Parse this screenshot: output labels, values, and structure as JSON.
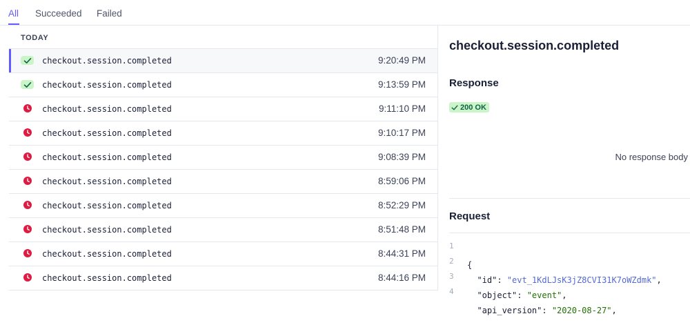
{
  "tabs": [
    {
      "label": "All",
      "active": true
    },
    {
      "label": "Succeeded",
      "active": false
    },
    {
      "label": "Failed",
      "active": false
    }
  ],
  "list": {
    "section_label": "TODAY",
    "events": [
      {
        "name": "checkout.session.completed",
        "time": "9:20:49 PM",
        "status": "succeeded",
        "selected": true
      },
      {
        "name": "checkout.session.completed",
        "time": "9:13:59 PM",
        "status": "succeeded"
      },
      {
        "name": "checkout.session.completed",
        "time": "9:11:10 PM",
        "status": "failed"
      },
      {
        "name": "checkout.session.completed",
        "time": "9:10:17 PM",
        "status": "failed"
      },
      {
        "name": "checkout.session.completed",
        "time": "9:08:39 PM",
        "status": "failed"
      },
      {
        "name": "checkout.session.completed",
        "time": "8:59:06 PM",
        "status": "failed"
      },
      {
        "name": "checkout.session.completed",
        "time": "8:52:29 PM",
        "status": "failed"
      },
      {
        "name": "checkout.session.completed",
        "time": "8:51:48 PM",
        "status": "failed"
      },
      {
        "name": "checkout.session.completed",
        "time": "8:44:31 PM",
        "status": "failed"
      },
      {
        "name": "checkout.session.completed",
        "time": "8:44:16 PM",
        "status": "failed"
      }
    ]
  },
  "detail": {
    "title": "checkout.session.completed",
    "response_heading": "Response",
    "status_badge": "200 OK",
    "no_body_text": "No response body",
    "request_heading": "Request",
    "code": {
      "line1": {
        "num": "1",
        "text": "{"
      },
      "line2": {
        "num": "2",
        "key": "  \"id\": ",
        "value": "\"evt_1KdLJsK3jZ8CVI31K7oWZdmk\"",
        "tail": ","
      },
      "line3": {
        "num": "3",
        "key": "  \"object\": ",
        "value": "\"event\"",
        "tail": ","
      },
      "line4": {
        "num": "4",
        "key": "  \"api_version\": ",
        "value": "\"2020-08-27\"",
        "tail": ","
      }
    }
  },
  "colors": {
    "accent": "#635bff",
    "success_bg": "#cbf4c9",
    "success_fg": "#0e6245",
    "failed": "#df1b41"
  },
  "icons": {
    "succeeded": "check-icon",
    "failed": "clock-icon"
  }
}
